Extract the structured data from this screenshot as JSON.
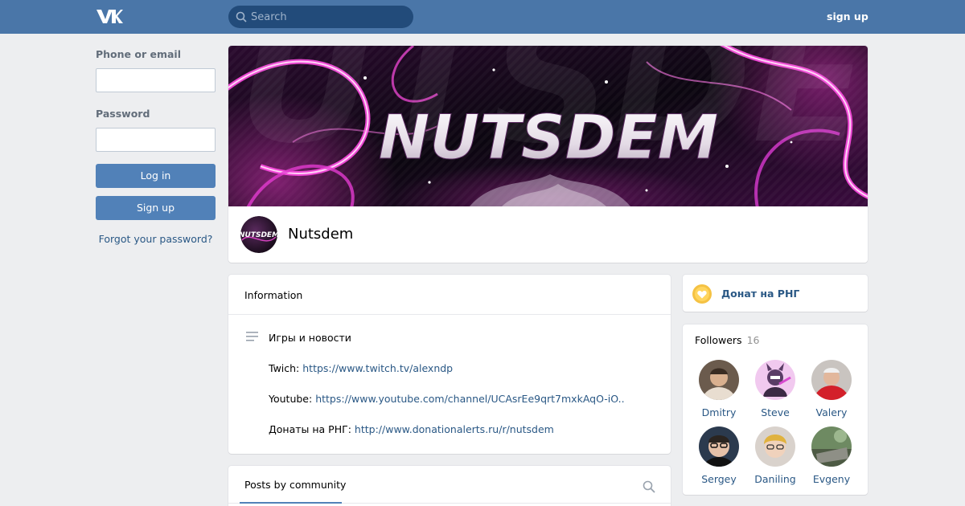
{
  "header": {
    "logo": "vk-logo",
    "search_placeholder": "Search",
    "signup_label": "sign up"
  },
  "login": {
    "phone_label": "Phone or email",
    "password_label": "Password",
    "login_button": "Log in",
    "signup_button": "Sign up",
    "forgot_link": "Forgot your password?"
  },
  "community": {
    "cover_text": "NUTSDEM",
    "avatar_text": "NUTSDEM",
    "name": "Nutsdem"
  },
  "information": {
    "title": "Information",
    "description": "Игры и новости",
    "twitch_label": "Twich: ",
    "twitch_url": "https://www.twitch.tv/alexndp",
    "youtube_label": "Youtube: ",
    "youtube_url": "https://www.youtube.com/channel/UCAsrEe9qrt7mxkAqO-iO..",
    "donate_label": "Донаты на РНГ: ",
    "donate_url": "http://www.donationalerts.ru/r/nutsdem"
  },
  "donate_widget": {
    "label": "Донат на РНГ",
    "icon": "heart-coin-icon"
  },
  "followers": {
    "title": "Followers",
    "count": "16",
    "people": [
      {
        "name": "Dmitry"
      },
      {
        "name": "Steve"
      },
      {
        "name": "Valery"
      },
      {
        "name": "Sergey"
      },
      {
        "name": "Daniling"
      },
      {
        "name": "Evgeny"
      }
    ]
  },
  "posts": {
    "tab_label": "Posts by community"
  },
  "colors": {
    "header_bg": "#4a76a8",
    "accent": "#5181b8",
    "link": "#2a5885",
    "page_bg": "#edeef0"
  }
}
